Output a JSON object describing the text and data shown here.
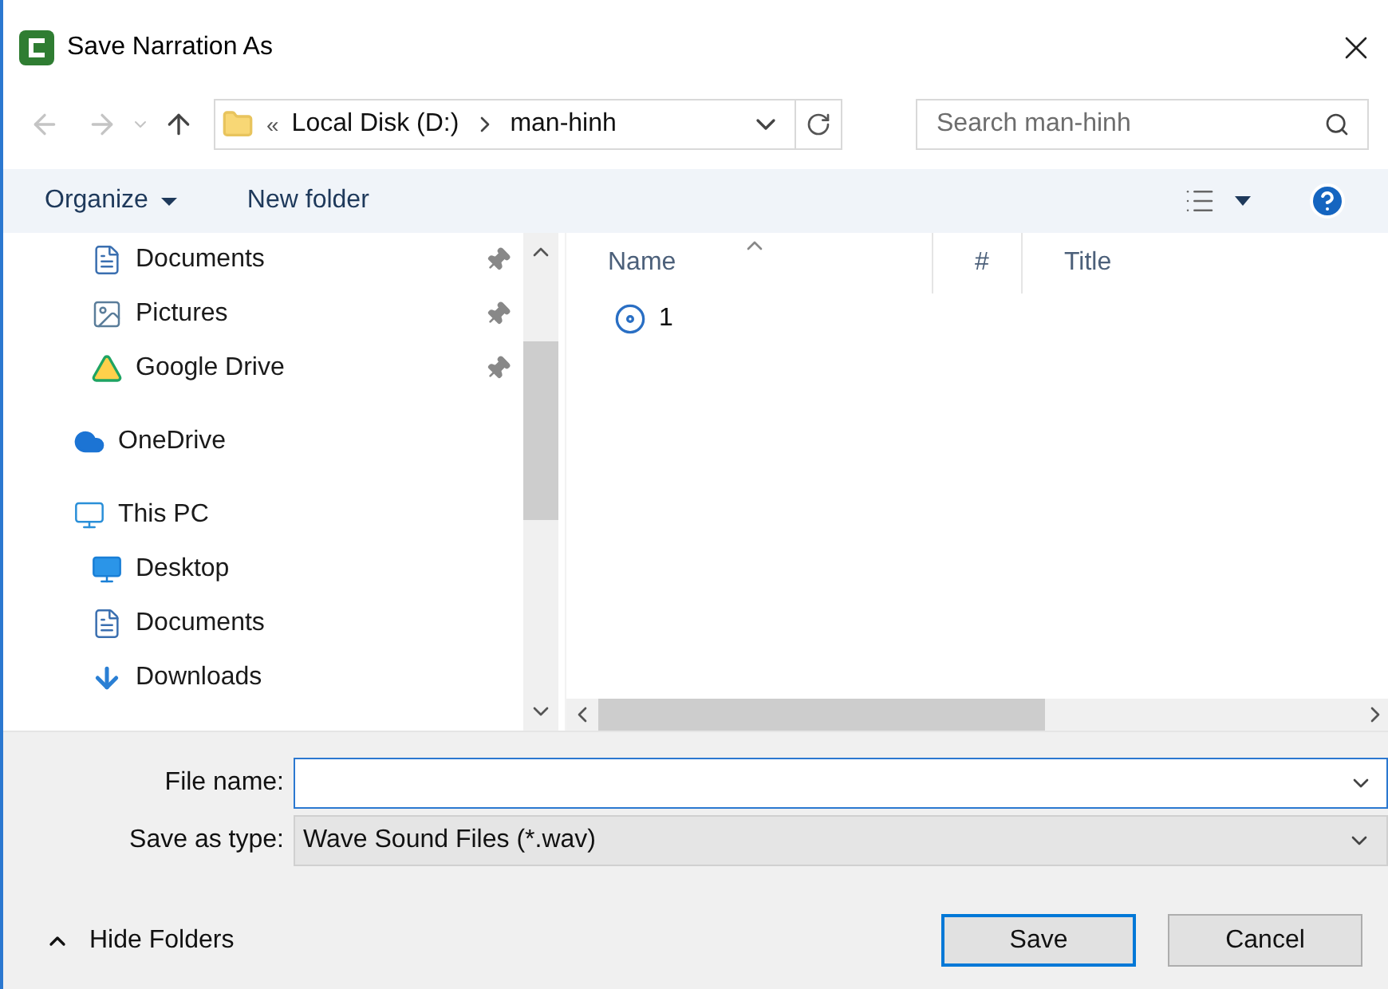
{
  "window": {
    "title": "Save Narration As"
  },
  "address_bar": {
    "overflow": "«",
    "parent": "Local Disk (D:)",
    "current": "man-hinh"
  },
  "search": {
    "placeholder": "Search man-hinh"
  },
  "toolbar": {
    "organize": "Organize",
    "new_folder": "New folder"
  },
  "quick_access_items": [
    {
      "label": "Documents",
      "kind": "document",
      "pinned": true
    },
    {
      "label": "Pictures",
      "kind": "pictures",
      "pinned": true
    },
    {
      "label": "Google Drive",
      "kind": "drive",
      "pinned": true
    }
  ],
  "tree": [
    {
      "label": "OneDrive",
      "kind": "cloud"
    },
    {
      "label": "This PC",
      "kind": "pc",
      "children": [
        {
          "label": "Desktop",
          "kind": "desktop"
        },
        {
          "label": "Documents",
          "kind": "document"
        },
        {
          "label": "Downloads",
          "kind": "download"
        }
      ]
    }
  ],
  "file_list": {
    "columns": [
      "Name",
      "#",
      "Title"
    ],
    "rows": [
      {
        "name": "1"
      }
    ]
  },
  "file_name": {
    "label": "File name:"
  },
  "save_as_type": {
    "label": "Save as type:",
    "value": "Wave Sound Files (*.wav)"
  },
  "hide_folders": "Hide Folders",
  "buttons": [
    {
      "label": "Save",
      "default": true
    },
    {
      "label": "Cancel",
      "default": false
    }
  ]
}
